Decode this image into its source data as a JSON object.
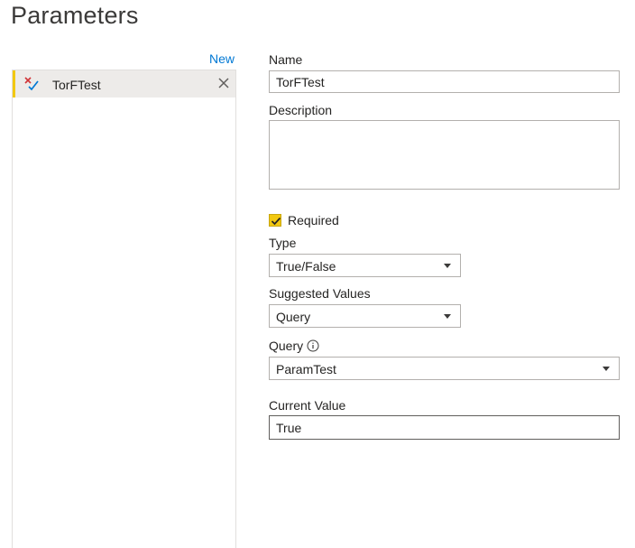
{
  "dialog": {
    "title": "Parameters",
    "new_link": "New"
  },
  "list": {
    "items": [
      {
        "label": "TorFTest",
        "icon": "true-false-icon"
      }
    ]
  },
  "form": {
    "name_label": "Name",
    "name_value": "TorFTest",
    "description_label": "Description",
    "description_value": "",
    "required_label": "Required",
    "required_checked": true,
    "type_label": "Type",
    "type_value": "True/False",
    "suggested_label": "Suggested Values",
    "suggested_value": "Query",
    "query_label": "Query",
    "query_value": "ParamTest",
    "current_label": "Current Value",
    "current_value": "True"
  },
  "colors": {
    "accent": "#f2c811",
    "link": "#0078d4",
    "selected_bg": "#edebe9"
  }
}
